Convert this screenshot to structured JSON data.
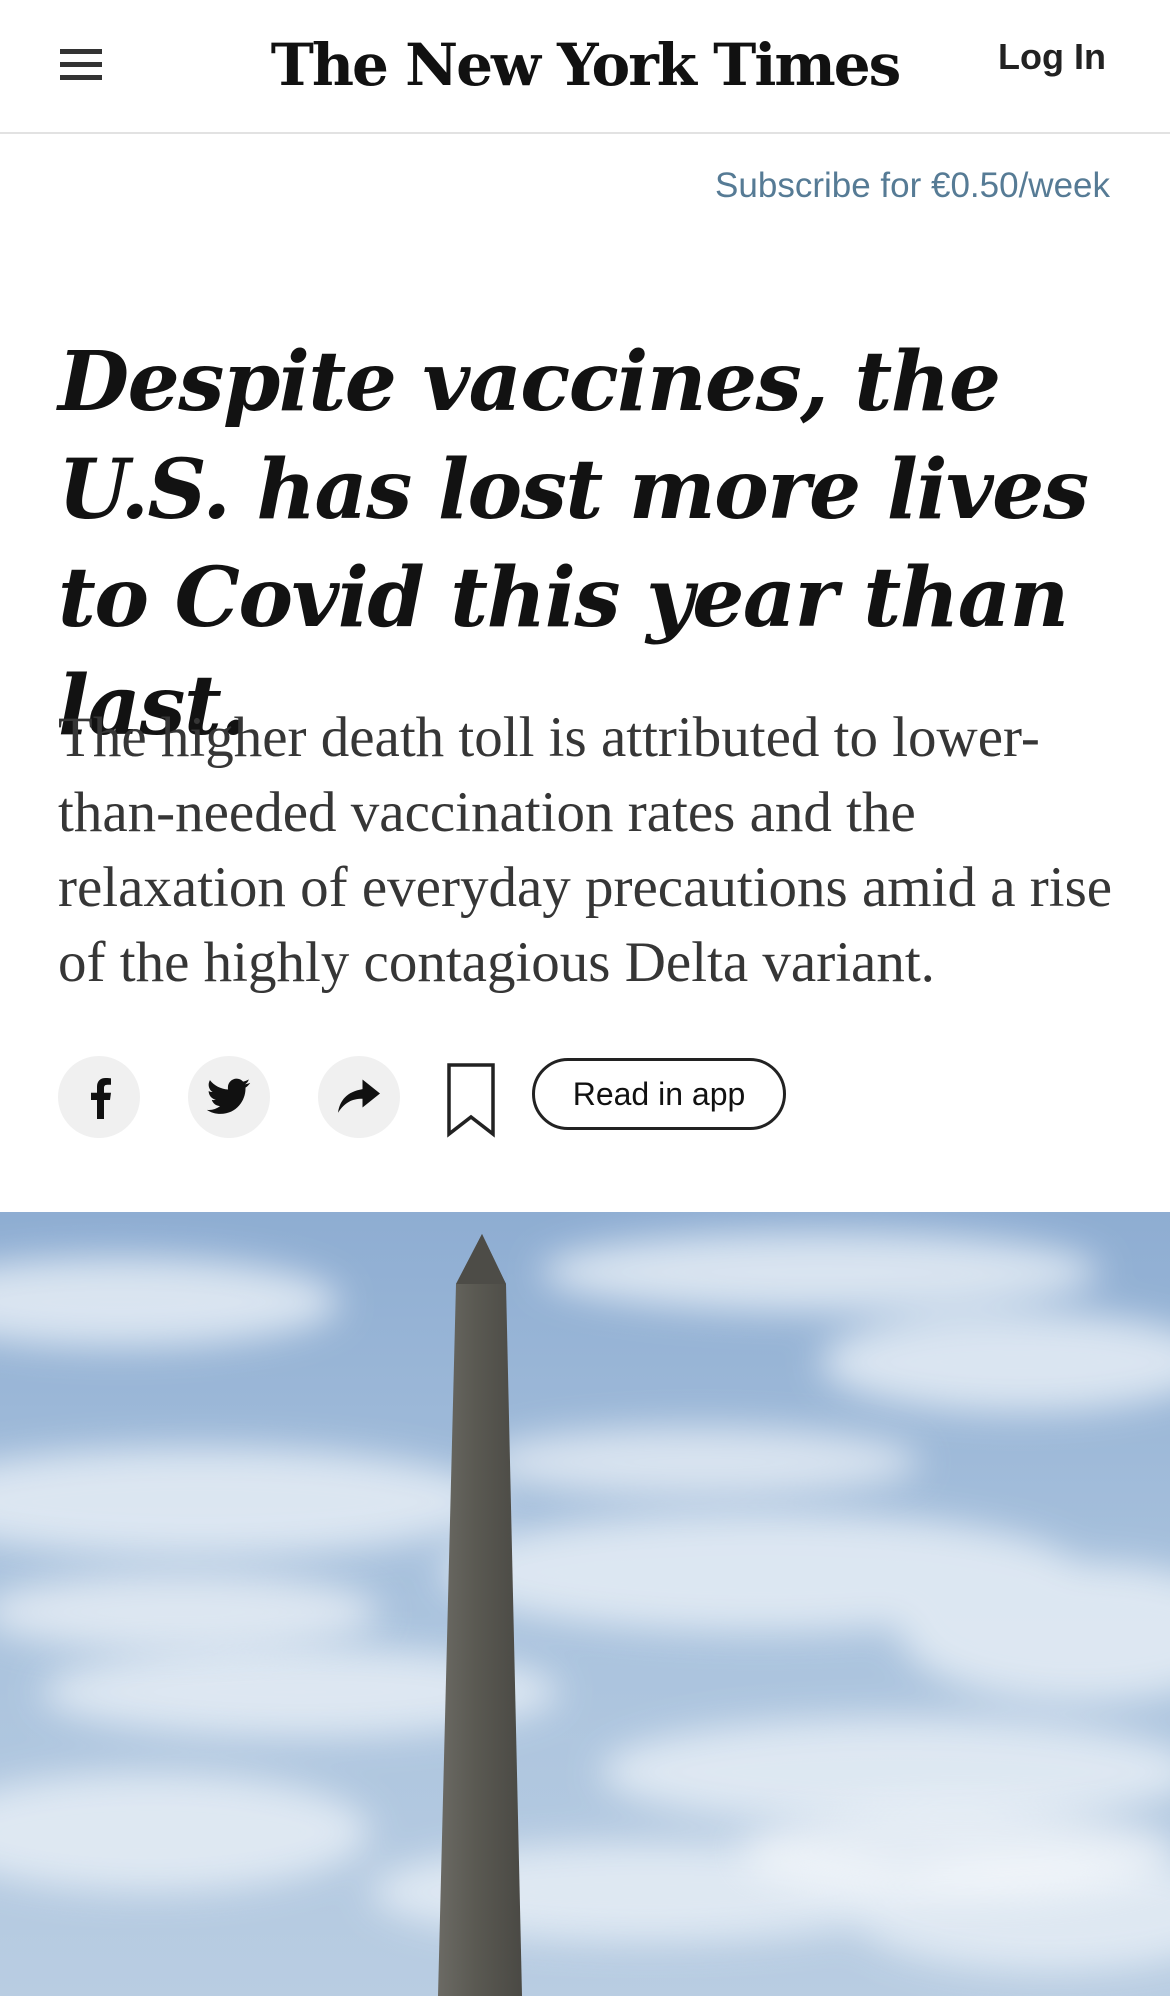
{
  "header": {
    "menu_icon": "hamburger-menu-icon",
    "masthead": "The New York Times",
    "login_label": "Log In"
  },
  "subscribe_text": "Subscribe for €0.50/week",
  "article": {
    "headline": "Despite vaccines, the U.S. has lost more lives to Covid this year than last.",
    "summary": "The higher death toll is attributed to lower-than-needed vaccination rates and the relaxation of everyday precautions amid a rise of the highly contagious Delta variant."
  },
  "share": {
    "facebook_icon": "facebook-icon",
    "twitter_icon": "twitter-icon",
    "share_icon": "share-arrow-icon",
    "bookmark_icon": "bookmark-icon",
    "read_in_app_label": "Read in app"
  },
  "hero_image": {
    "subject": "Washington Monument against a cloudy blue sky"
  },
  "colors": {
    "subscribe_link": "#567b95",
    "text": "#121212",
    "summary_text": "#363636",
    "icon_button_bg": "#f0f0f0",
    "sky": "#8fb0d4"
  }
}
